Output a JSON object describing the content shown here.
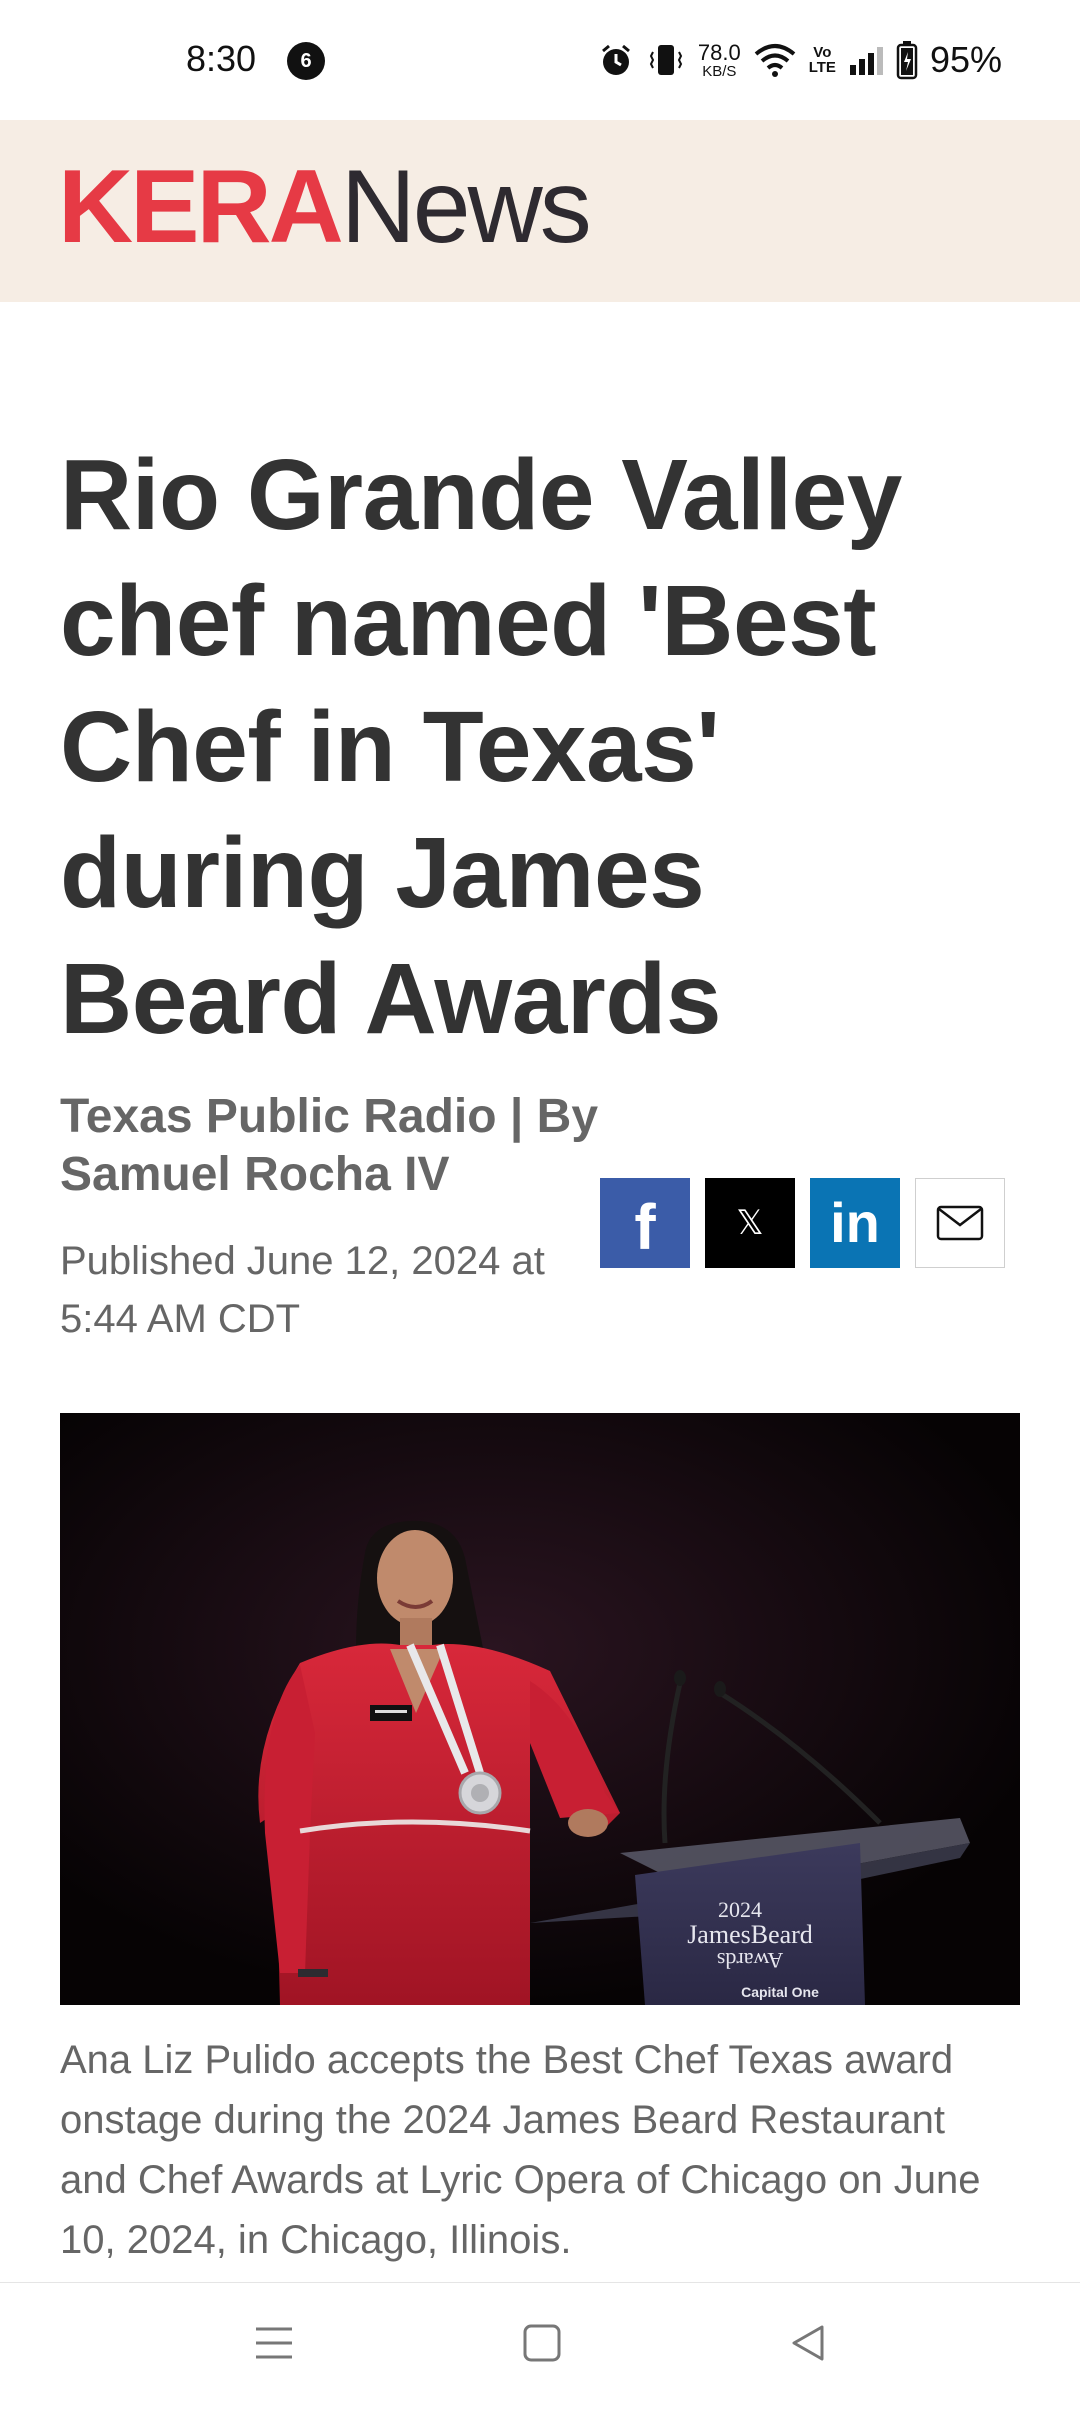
{
  "status_bar": {
    "time": "8:30",
    "notification_count": "6",
    "net_speed_value": "78.0",
    "net_speed_unit": "KB/S",
    "volte_top": "Vo",
    "volte_bottom": "LTE",
    "battery": "95%",
    "icons": [
      "alarm-icon",
      "vibrate-icon",
      "wifi-icon",
      "signal-icon",
      "battery-icon"
    ]
  },
  "header": {
    "logo_kera": "KERA",
    "logo_news": "News",
    "colors": {
      "background": "#f6ede4",
      "kera": "#e63a45",
      "news": "#2e2a30"
    }
  },
  "article": {
    "headline": "Rio Grande Valley chef named 'Best Chef in Texas' during James Beard Awards",
    "byline": "Texas Public Radio | By Samuel Rocha IV",
    "published": "Published June 12, 2024 at 5:44 AM CDT",
    "image": {
      "podium_line1": "2024",
      "podium_line2": "JamesBeard",
      "podium_line3": "Awards",
      "podium_sponsor": "Capital One"
    },
    "caption": "Ana Liz Pulido accepts the Best Chef Texas award onstage during the 2024 James Beard Restaurant and Chef Awards at Lyric Opera of Chicago on June 10, 2024, in Chicago, Illinois."
  },
  "share": {
    "facebook_glyph": "f",
    "x_glyph": "𝕏",
    "linkedin_glyph": "in",
    "colors": {
      "facebook": "#3b5ca8",
      "x": "#000000",
      "linkedin": "#0a74b4"
    }
  },
  "nav_bar": {
    "icons": [
      "menu-icon",
      "home-square-icon",
      "back-triangle-icon"
    ]
  }
}
